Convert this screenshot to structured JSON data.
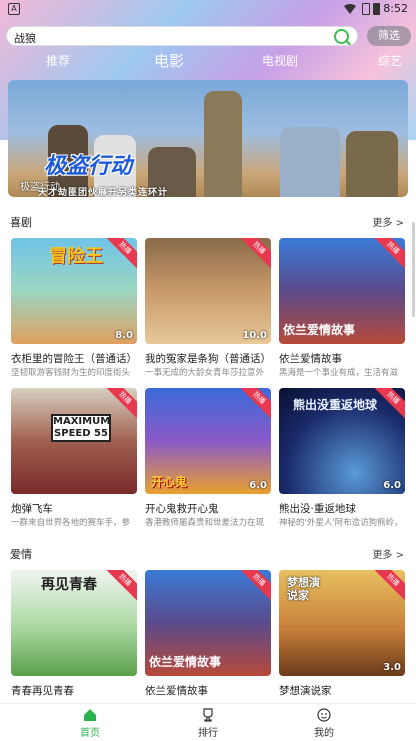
{
  "status_bar": {
    "time": "8:52",
    "app_icon": "A"
  },
  "search": {
    "value": "战狼"
  },
  "filter_label": "筛选",
  "tabs": [
    {
      "label": "推荐",
      "active": false
    },
    {
      "label": "电影",
      "active": true
    },
    {
      "label": "电视剧",
      "active": false
    },
    {
      "label": "综艺",
      "active": false
    }
  ],
  "banner": {
    "title": "极盗行动",
    "subtitle": "极盗行动",
    "caption": "天才劫匪团伙展开另类连环计"
  },
  "sections": [
    {
      "name": "喜剧",
      "more": "更多 >",
      "items": [
        {
          "title": "衣柜里的冒险王（普通话）",
          "desc": "坚韧取游客钱财为生的印度街头",
          "score": "8.0",
          "badge": "热播",
          "poster_text": "冒险王"
        },
        {
          "title": "我的冤家是条狗（普通话）",
          "desc": "一事无成的大龄女青年莎拉意外",
          "score": "10.0",
          "badge": "热播",
          "poster_text": ""
        },
        {
          "title": "依兰爱情故事",
          "desc": "黑海是一个事业有成，生活有滋",
          "score": "",
          "badge": "热播",
          "poster_text": "依兰爱情故事"
        },
        {
          "title": "炮弹飞车",
          "desc": "一群来自世界各地的赛车手，参",
          "score": "",
          "badge": "热播",
          "poster_text": "MAXIMUM SPEED 55"
        },
        {
          "title": "开心鬼救开心鬼",
          "desc": "香港教师屡森贵和世差法力在现",
          "score": "6.0",
          "badge": "热播",
          "poster_text": "开心鬼"
        },
        {
          "title": "熊出没·重返地球",
          "desc": "神秘的'外星人'阿布造访狗熊岭，",
          "score": "6.0",
          "badge": "热播",
          "poster_text": "熊出没重返地球"
        }
      ]
    },
    {
      "name": "爱情",
      "more": "更多 >",
      "items": [
        {
          "title": "青春再见青春",
          "desc": "",
          "score": "",
          "badge": "热播",
          "poster_text": "再见青春"
        },
        {
          "title": "依兰爱情故事",
          "desc": "",
          "score": "",
          "badge": "热播",
          "poster_text": "依兰爱情故事"
        },
        {
          "title": "梦想演说家",
          "desc": "",
          "score": "3.0",
          "badge": "热播",
          "poster_text": "梦想演说家"
        }
      ]
    }
  ],
  "bottom_nav": [
    {
      "label": "首页",
      "icon": "home-icon",
      "active": true
    },
    {
      "label": "排行",
      "icon": "trophy-icon",
      "active": false
    },
    {
      "label": "我的",
      "icon": "profile-icon",
      "active": false
    }
  ],
  "colors": {
    "accent": "#2bb24c",
    "badge": "#e8384f"
  }
}
